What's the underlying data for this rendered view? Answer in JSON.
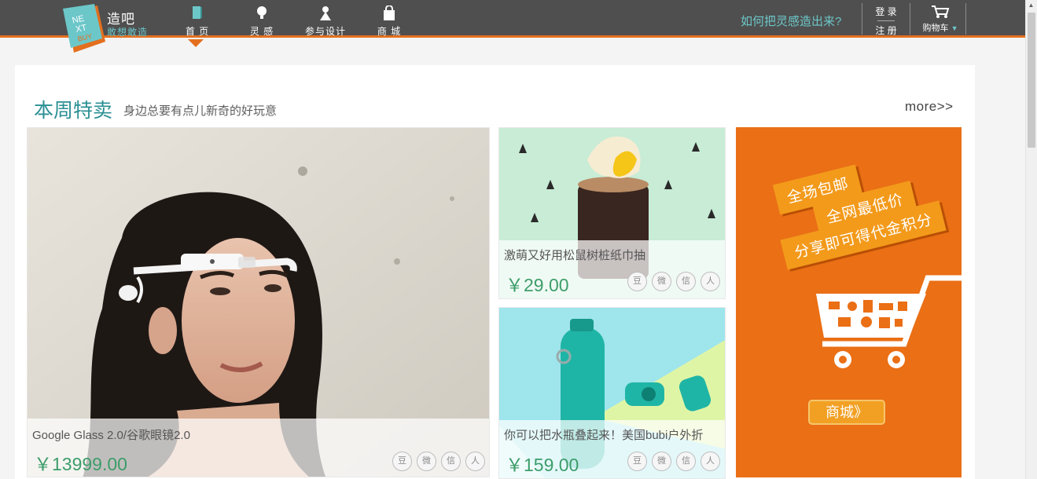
{
  "brand": {
    "name": "造吧",
    "slogan": "敢想敢造"
  },
  "nav": [
    {
      "label": "首 页",
      "icon": "book-icon"
    },
    {
      "label": "灵 感",
      "icon": "lightbulb-icon"
    },
    {
      "label": "参与设计",
      "icon": "person-icon"
    },
    {
      "label": "商 城",
      "icon": "shopping-bag-icon"
    }
  ],
  "header": {
    "inspire_link": "如何把灵感造出来?",
    "login": "登 录",
    "register": "注 册",
    "cart": "购物车"
  },
  "section": {
    "title": "本周特卖",
    "subtitle": "身边总要有点儿新奇的好玩意",
    "more": "more>>"
  },
  "products": [
    {
      "name": "Google Glass 2.0/谷歌眼镜2.0",
      "price": "￥13999.00"
    },
    {
      "name": "激萌又好用松鼠树桩纸巾抽",
      "price": "￥29.00"
    },
    {
      "name": "你可以把水瓶叠起来！美国bubi户外折",
      "price": "￥159.00"
    }
  ],
  "share_icons": [
    "豆",
    "微",
    "信",
    "人"
  ],
  "promo": {
    "tags": [
      "全场包邮",
      "全网最低价",
      "分享即可得代金积分"
    ],
    "shop_button": "商城》"
  },
  "colors": {
    "topbar": "#4f4f4f",
    "accent_orange": "#e36f1e",
    "accent_teal": "#6cc7c9",
    "price_green": "#3d9d6a"
  }
}
